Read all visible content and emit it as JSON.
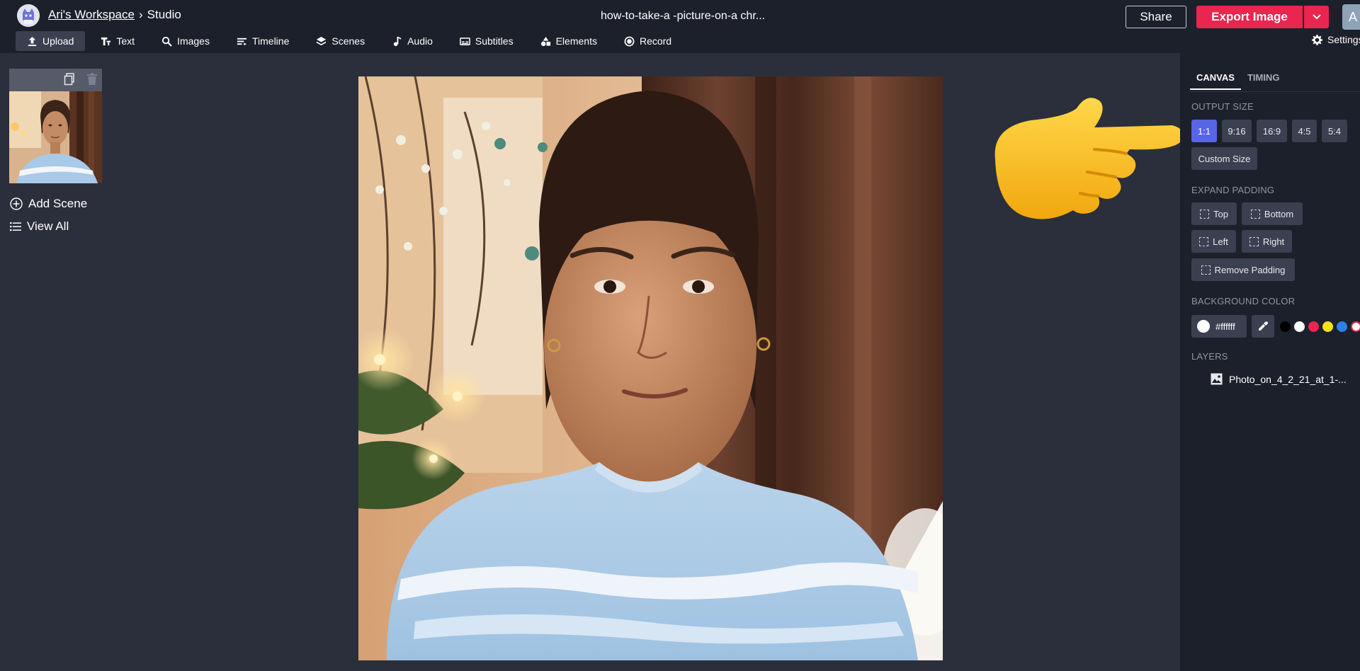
{
  "header": {
    "workspace": "Ari's Workspace",
    "separator": "›",
    "section": "Studio",
    "doc_title": "how-to-take-a -picture-on-a chr...",
    "share_label": "Share",
    "export_label": "Export Image",
    "account_initial": "A"
  },
  "toolbar": {
    "items": [
      {
        "label": "Upload",
        "icon": "upload-icon"
      },
      {
        "label": "Text",
        "icon": "text-icon"
      },
      {
        "label": "Images",
        "icon": "search-icon"
      },
      {
        "label": "Timeline",
        "icon": "timeline-icon"
      },
      {
        "label": "Scenes",
        "icon": "layers-icon"
      },
      {
        "label": "Audio",
        "icon": "music-note-icon"
      },
      {
        "label": "Subtitles",
        "icon": "subtitles-icon"
      },
      {
        "label": "Elements",
        "icon": "shapes-icon"
      },
      {
        "label": "Record",
        "icon": "record-icon"
      }
    ],
    "settings_label": "Settings"
  },
  "scenes": {
    "add_label": "Add Scene",
    "view_all_label": "View All"
  },
  "panel": {
    "tabs": [
      "CANVAS",
      "TIMING"
    ],
    "output_size_label": "OUTPUT SIZE",
    "sizes": [
      "1:1",
      "9:16",
      "16:9",
      "4:5",
      "5:4"
    ],
    "selected_size": "1:1",
    "custom_size_label": "Custom Size",
    "expand_padding_label": "EXPAND PADDING",
    "padding": {
      "top": "Top",
      "bottom": "Bottom",
      "left": "Left",
      "right": "Right",
      "remove": "Remove Padding"
    },
    "background_color_label": "BACKGROUND COLOR",
    "background_color": "#ffffff",
    "swatches": [
      "#000000",
      "#ffffff",
      "#e8264f",
      "#f5e11a",
      "#2f7fe6"
    ],
    "layers_label": "LAYERS",
    "layers": [
      {
        "name": "Photo_on_4_2_21_at_1-..."
      }
    ]
  },
  "colors": {
    "accent": "#e8264f",
    "selected": "#5865e6",
    "topbar": "#1c202a",
    "workspace": "#2b2f3b"
  }
}
